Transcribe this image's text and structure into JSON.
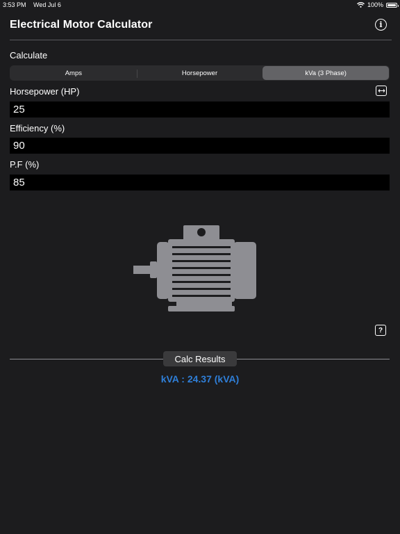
{
  "status_bar": {
    "time": "3:53 PM",
    "date": "Wed Jul 6",
    "battery": "100%"
  },
  "header": {
    "title": "Electrical Motor Calculator",
    "info_icon": "i"
  },
  "calculate": {
    "label": "Calculate",
    "options": [
      "Amps",
      "Horsepower",
      "kVa (3 Phase)"
    ],
    "selected": "kVa (3 Phase)"
  },
  "fields": {
    "horsepower": {
      "label": "Horsepower (HP)",
      "value": "25"
    },
    "efficiency": {
      "label": "Efficiency (%)",
      "value": "90"
    },
    "power_factor": {
      "label": "P.F (%)",
      "value": "85"
    }
  },
  "icons": {
    "swap": "swap-units-icon",
    "motor": "electric-motor-icon",
    "help": "help-icon"
  },
  "results": {
    "label": "Calc Results",
    "value": "kVA : 24.37 (kVA)"
  },
  "colors": {
    "background": "#1c1c1e",
    "accent": "#2f7fd9",
    "field_bg": "#000000",
    "segment_selected": "#636366"
  }
}
